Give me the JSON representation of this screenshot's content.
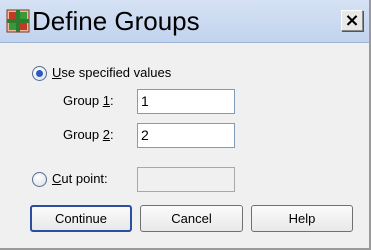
{
  "dialog": {
    "title": "Define Groups",
    "close_label": "×"
  },
  "options": {
    "use_specified": {
      "label": "Use specified values",
      "selected": true
    },
    "group1": {
      "label_prefix": "Group ",
      "label_key": "1",
      "label_suffix": ":",
      "value": "1"
    },
    "group2": {
      "label_prefix": "Group ",
      "label_key": "2",
      "label_suffix": ":",
      "value": "2"
    },
    "cut_point": {
      "label": "Cut point:",
      "selected": false,
      "value": ""
    }
  },
  "buttons": {
    "continue": "Continue",
    "cancel": "Cancel",
    "help": "Help"
  },
  "colors": {
    "title_bar": "#c1d3ee",
    "window_bg": "#f0f0f0",
    "radio_dot": "#2a5cc0"
  }
}
